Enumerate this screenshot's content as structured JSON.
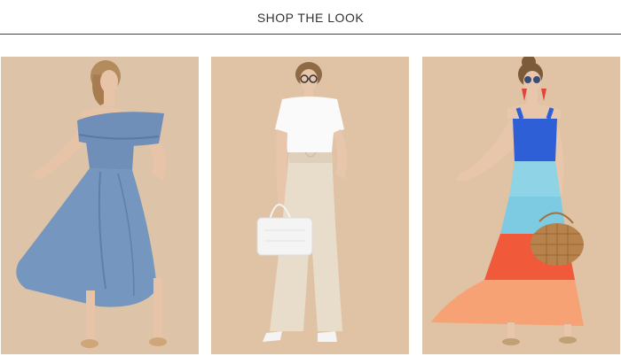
{
  "header": {
    "title": "SHOP THE LOOK"
  },
  "products": [
    {
      "name": "blue-off-shoulder-maxi-dress",
      "colors": {
        "background": "#ddc3a7",
        "garment": "#6f8fb8",
        "skin": "#e7c4a8",
        "hair": "#b38b5c"
      }
    },
    {
      "name": "white-top-beige-wide-pants",
      "colors": {
        "background": "#e0c3a4",
        "top": "#fafafa",
        "pants": "#e8dccb",
        "skin": "#e8c6ab",
        "hair": "#8e6a45"
      }
    },
    {
      "name": "colorblock-tiered-maxi-dress",
      "colors": {
        "background": "#e0c3a4",
        "bodice": "#2f5fd6",
        "tier1": "#8ed3e6",
        "tier2": "#f05a3a",
        "tier3": "#f6a274",
        "bag": "#b7824b",
        "skin": "#e8c6ab"
      }
    }
  ]
}
